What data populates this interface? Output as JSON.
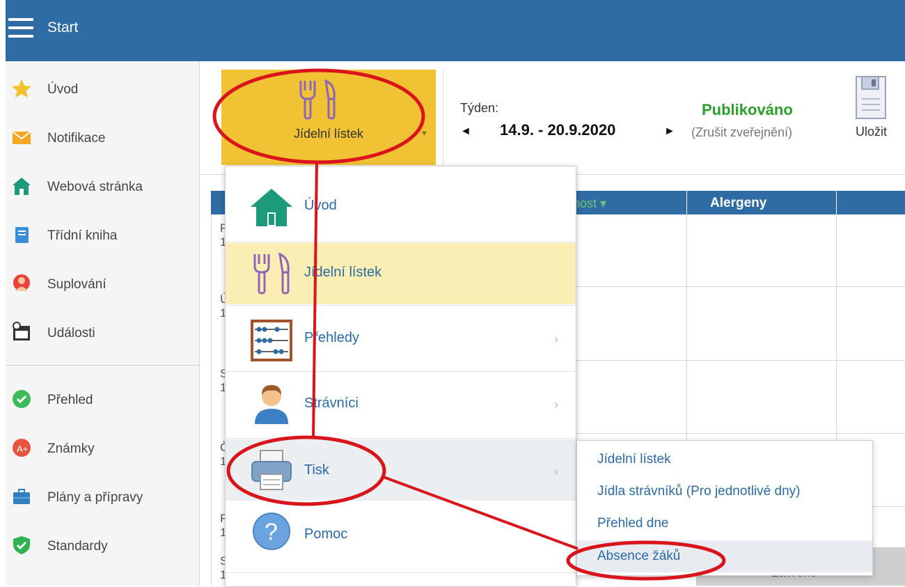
{
  "topbar": {
    "title": "Start",
    "color": "#2f6ca3"
  },
  "sidebar": {
    "items": [
      {
        "label": "Úvod",
        "icon": "star-icon"
      },
      {
        "label": "Notifikace",
        "icon": "envelope-icon"
      },
      {
        "label": "Webová stránka",
        "icon": "house-icon"
      },
      {
        "label": "Třídní kniha",
        "icon": "book-icon"
      },
      {
        "label": "Suplování",
        "icon": "person-circle-icon"
      },
      {
        "label": "Události",
        "icon": "calendar-icon"
      },
      {
        "label": "Přehled",
        "icon": "check-circle-icon"
      },
      {
        "label": "Známky",
        "icon": "grade-icon"
      },
      {
        "label": "Plány a přípravy",
        "icon": "briefcase-icon"
      },
      {
        "label": "Standardy",
        "icon": "shield-check-icon"
      }
    ]
  },
  "toolbar": {
    "menu_button_label": "Jídelní lístek",
    "week_label": "Týden:",
    "week_range": "14.9. - 20.9.2020",
    "prev_arrow": "◄",
    "next_arrow": "►",
    "status": "Publikováno",
    "unpublish": "(Zrušit zveřejnění)",
    "save": "Uložit"
  },
  "table": {
    "col_nost": "nost ▾",
    "col_alergeny": "Alergeny",
    "row_fragments": [
      "P\n1",
      "Ú\n1",
      "S\n1",
      "Č\n1",
      "P\n1",
      "S\n1"
    ],
    "closed": "Zavřeno"
  },
  "dropdown": {
    "items": [
      {
        "label": "Úvod",
        "icon": "house-icon",
        "chevron": false
      },
      {
        "label": "Jídelní lístek",
        "icon": "fork-knife-icon",
        "chevron": false,
        "selected": true
      },
      {
        "label": "Přehledy",
        "icon": "abacus-icon",
        "chevron": true
      },
      {
        "label": "Strávníci",
        "icon": "person-icon",
        "chevron": true
      },
      {
        "label": "Tisk",
        "icon": "printer-icon",
        "chevron": true,
        "hovered": true
      },
      {
        "label": "Pomoc",
        "icon": "question-icon",
        "chevron": false
      }
    ]
  },
  "submenu": {
    "items": [
      {
        "label": "Jídelní lístek"
      },
      {
        "label": "Jídla strávníků (Pro jednotlivé dny)"
      },
      {
        "label": "Přehled dne"
      },
      {
        "label": "Absence žáků",
        "hovered": true
      }
    ]
  },
  "annotation_color": "#d9141b"
}
